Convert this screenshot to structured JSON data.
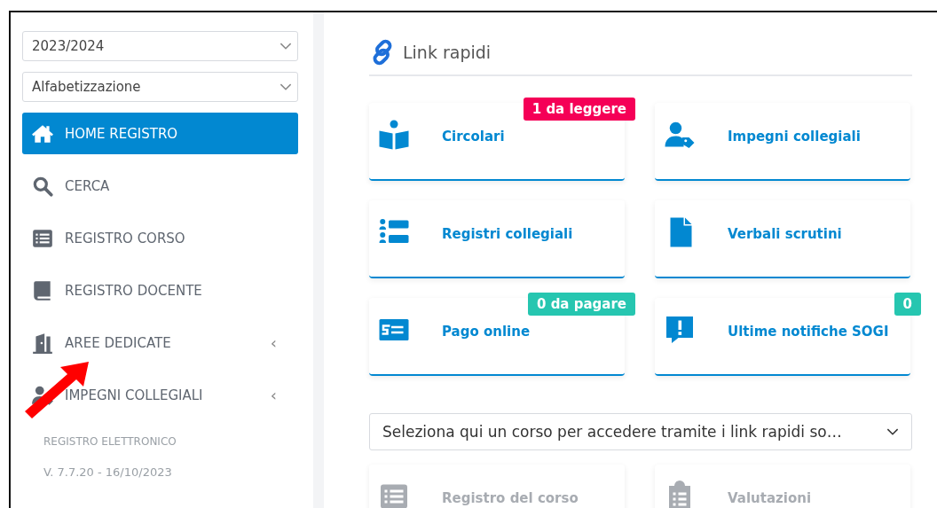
{
  "sidebar": {
    "selects": [
      {
        "value": "2023/2024"
      },
      {
        "value": "Alfabetizzazione"
      }
    ],
    "items": [
      {
        "label": "HOME REGISTRO",
        "selected": true
      },
      {
        "label": "CERCA",
        "selected": false
      },
      {
        "label": "REGISTRO CORSO",
        "selected": false
      },
      {
        "label": "REGISTRO DOCENTE",
        "selected": false
      },
      {
        "label": "AREE DEDICATE",
        "selected": false,
        "chevron": "‹"
      },
      {
        "label": "IMPEGNI COLLEGIALI",
        "selected": false,
        "chevron": "‹"
      }
    ],
    "footer": [
      "REGISTRO ELETTRONICO",
      "V. 7.7.20 - 16/10/2023"
    ]
  },
  "main": {
    "title": "Link rapidi",
    "cards": [
      {
        "label": "Circolari",
        "badge": "1 da leggere",
        "color": "#f50057",
        "disabled": false
      },
      {
        "label": "Impegni collegiali",
        "disabled": false
      },
      {
        "label": "Registri collegiali",
        "disabled": false
      },
      {
        "label": "Verbali scrutini",
        "disabled": false
      },
      {
        "label": "Pago online",
        "badge": "0 da pagare",
        "color": "#26c6b0",
        "disabled": false
      },
      {
        "label": "Ultime notifiche SOGI",
        "badge": "0",
        "color": "#26c6b0",
        "disabled": false
      }
    ],
    "course_select": {
      "value": "Seleziona qui un corso per accedere tramite i link rapidi so…"
    },
    "course_cards": [
      {
        "label": "Registro del corso",
        "disabled": true
      },
      {
        "label": "Valutazioni",
        "disabled": true
      }
    ]
  }
}
